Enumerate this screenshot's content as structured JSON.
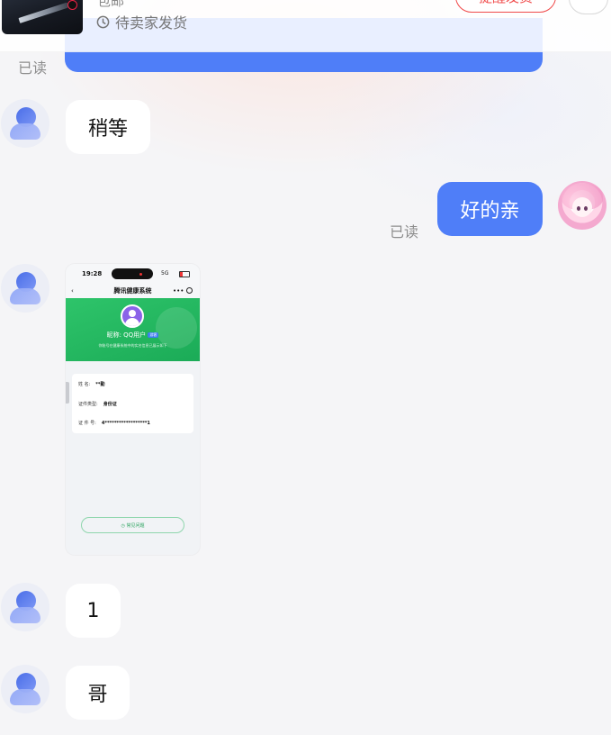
{
  "order": {
    "shipping_label": "包邮",
    "status_text": "待卖家发货",
    "remind_button": "提醒发货"
  },
  "messages": [
    {
      "from": "seller",
      "read_mark": "已读"
    },
    {
      "from": "seller",
      "text": "稍等"
    },
    {
      "from": "me",
      "text": "好的亲",
      "read_mark": "已读"
    },
    {
      "from": "seller",
      "type": "image",
      "screenshot": {
        "time": "19:28",
        "signal": "5G",
        "nav_back": "‹",
        "nav_title": "腾讯健康系统",
        "nav_more": "•••",
        "nickname": "昵称: QQ用户",
        "badge": "游客",
        "desc": "你账号在健康系统中的实名信息已展示如下",
        "rows": [
          {
            "key": "姓        名:",
            "value": "**勤"
          },
          {
            "key": "证件类型:",
            "value": "身份证"
          },
          {
            "key": "证 件 号:",
            "value": "4******************1"
          }
        ],
        "help_button": "◷ 常见问题"
      }
    },
    {
      "from": "seller",
      "text": "1"
    },
    {
      "from": "seller",
      "text": "哥"
    }
  ],
  "colors": {
    "accent": "#4f7ef8",
    "remind": "#f04a4a",
    "shot_green": "#1bab57"
  },
  "icons": {
    "status": "clock-icon",
    "seller_avatar": "user-silhouette-icon",
    "my_avatar": "anime-girl-avatar"
  }
}
